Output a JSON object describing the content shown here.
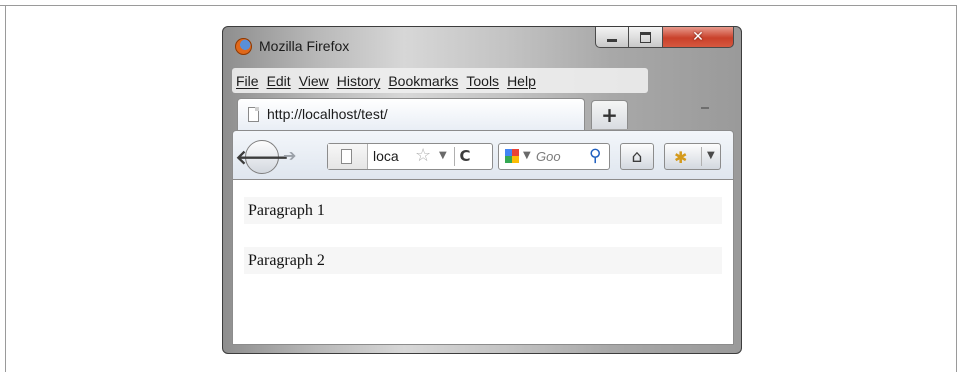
{
  "window": {
    "title": "Mozilla Firefox"
  },
  "window_controls": {
    "minimize": "minimize",
    "maximize": "maximize",
    "close": "✕"
  },
  "menubar": {
    "items": [
      {
        "label": "File"
      },
      {
        "label": "Edit"
      },
      {
        "label": "View"
      },
      {
        "label": "History"
      },
      {
        "label": "Bookmarks"
      },
      {
        "label": "Tools"
      },
      {
        "label": "Help"
      }
    ]
  },
  "tab": {
    "label": "http://localhost/test/"
  },
  "new_tab": {
    "label": "+"
  },
  "navbar": {
    "back": "🡐",
    "forward": "➔",
    "url": "loca",
    "reload": "C",
    "search_placeholder": "Goo",
    "icons": {
      "back": "back-arrow-icon",
      "forward": "forward-arrow-icon",
      "page": "page-icon",
      "bookmark": "star-icon",
      "reload": "reload-icon",
      "search_engine": "google-icon",
      "search": "magnifier-icon",
      "home": "home-icon",
      "addon": "addon-icon"
    }
  },
  "content": {
    "paragraphs": [
      "Paragraph 1",
      "Paragraph 2"
    ]
  }
}
